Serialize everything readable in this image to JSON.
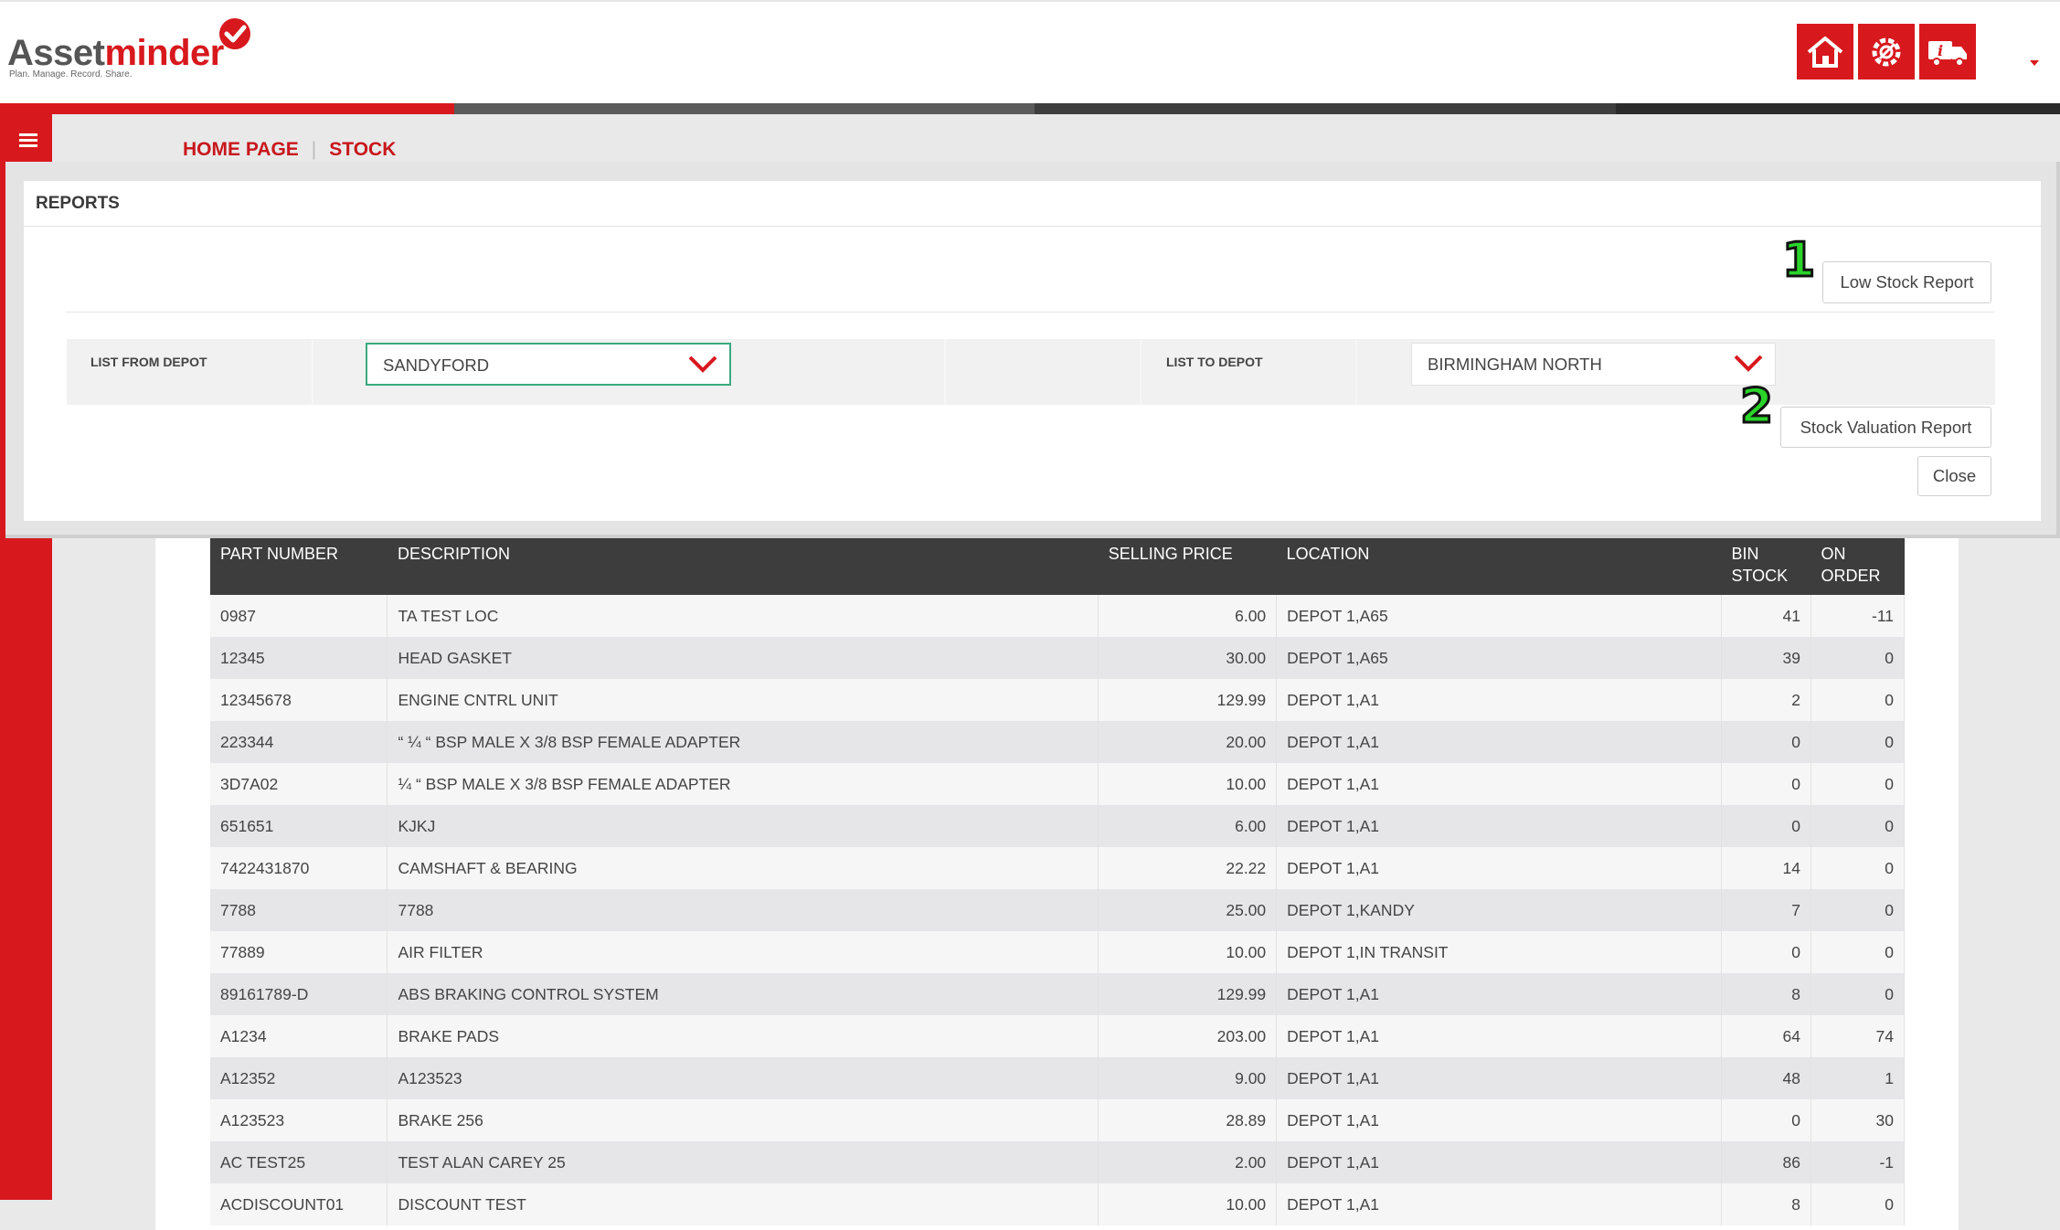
{
  "header": {
    "logo_word_a": "Asset",
    "logo_word_b": "minder",
    "logo_tagline": "Plan. Manage. Record. Share.",
    "icons": [
      "home-icon",
      "settings-gear-icon",
      "vehicle-info-icon"
    ]
  },
  "breadcrumb": {
    "home": "HOME PAGE",
    "current": "STOCK"
  },
  "reports": {
    "title": "REPORTS",
    "low_stock_button": "Low Stock Report",
    "stock_valuation_button": "Stock Valuation Report",
    "close_button": "Close",
    "list_from_label": "LIST FROM DEPOT",
    "list_from_value": "SANDYFORD",
    "list_to_label": "LIST TO DEPOT",
    "list_to_value": "BIRMINGHAM NORTH",
    "marker_1": "1",
    "marker_2": "2"
  },
  "table": {
    "columns": [
      "PART NUMBER",
      "DESCRIPTION",
      "SELLING PRICE",
      "LOCATION",
      "BIN STOCK",
      "ON ORDER"
    ],
    "rows": [
      [
        "0987",
        "TA TEST LOC",
        "6.00",
        "DEPOT 1,A65",
        "41",
        "-11"
      ],
      [
        "12345",
        "HEAD GASKET",
        "30.00",
        "DEPOT 1,A65",
        "39",
        "0"
      ],
      [
        "12345678",
        "ENGINE CNTRL UNIT",
        "129.99",
        "DEPOT 1,A1",
        "2",
        "0"
      ],
      [
        "223344",
        "“ ¼ “ BSP MALE X 3/8 BSP FEMALE ADAPTER",
        "20.00",
        "DEPOT 1,A1",
        "0",
        "0"
      ],
      [
        "3D7A02",
        "¼ “ BSP MALE X 3/8 BSP FEMALE ADAPTER",
        "10.00",
        "DEPOT 1,A1",
        "0",
        "0"
      ],
      [
        "651651",
        "KJKJ",
        "6.00",
        "DEPOT 1,A1",
        "0",
        "0"
      ],
      [
        "7422431870",
        "CAMSHAFT & BEARING",
        "22.22",
        "DEPOT 1,A1",
        "14",
        "0"
      ],
      [
        "7788",
        "7788",
        "25.00",
        "DEPOT 1,KANDY",
        "7",
        "0"
      ],
      [
        "77889",
        "AIR FILTER",
        "10.00",
        "DEPOT 1,IN TRANSIT",
        "0",
        "0"
      ],
      [
        "89161789-D",
        "ABS BRAKING CONTROL SYSTEM",
        "129.99",
        "DEPOT 1,A1",
        "8",
        "0"
      ],
      [
        "A1234",
        "BRAKE PADS",
        "203.00",
        "DEPOT 1,A1",
        "64",
        "74"
      ],
      [
        "A12352",
        "A123523",
        "9.00",
        "DEPOT 1,A1",
        "48",
        "1"
      ],
      [
        "A123523",
        "BRAKE 256",
        "28.89",
        "DEPOT 1,A1",
        "0",
        "30"
      ],
      [
        "AC TEST25",
        "TEST ALAN CAREY 25",
        "2.00",
        "DEPOT 1,A1",
        "86",
        "-1"
      ],
      [
        "ACDISCOUNT01",
        "DISCOUNT TEST",
        "10.00",
        "DEPOT 1,A1",
        "8",
        "0"
      ]
    ]
  },
  "colors": {
    "brand_red": "#d7191e",
    "table_header": "#3d3d3d",
    "active_border": "#3aaa7e"
  }
}
